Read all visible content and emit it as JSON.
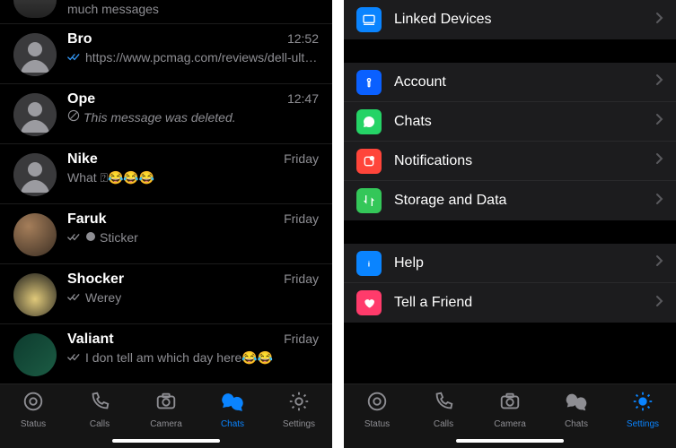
{
  "left": {
    "partial": {
      "msg": "much messages"
    },
    "chats": [
      {
        "name": "Bro",
        "time": "12:52",
        "ticks": "read",
        "msg": "https://www.pcmag.com/reviews/dell-ultrasharp-43-4k-usb-c-monito…",
        "avatar": "default"
      },
      {
        "name": "Ope",
        "time": "12:47",
        "ticks": "none",
        "prefix": "deleted",
        "msg": "This message was deleted.",
        "avatar": "default"
      },
      {
        "name": "Nike",
        "time": "Friday",
        "ticks": "none",
        "msg": "What ⍰😂😂😂",
        "avatar": "default"
      },
      {
        "name": "Faruk",
        "time": "Friday",
        "ticks": "sent",
        "prefix": "sticker",
        "msg": "Sticker",
        "avatar": "photo1"
      },
      {
        "name": "Shocker",
        "time": "Friday",
        "ticks": "sent",
        "msg": "Werey",
        "avatar": "photo2"
      },
      {
        "name": "Valiant",
        "time": "Friday",
        "ticks": "sent",
        "msg": "I don tell am which day here😂😂",
        "avatar": "photo3"
      }
    ]
  },
  "right": {
    "groups": [
      [
        {
          "icon": "linked",
          "label": "Linked Devices"
        }
      ],
      [
        {
          "icon": "account",
          "label": "Account"
        },
        {
          "icon": "chats",
          "label": "Chats"
        },
        {
          "icon": "notif",
          "label": "Notifications"
        },
        {
          "icon": "storage",
          "label": "Storage and Data"
        }
      ],
      [
        {
          "icon": "help",
          "label": "Help"
        },
        {
          "icon": "tell",
          "label": "Tell a Friend"
        }
      ]
    ]
  },
  "tabs": {
    "items": [
      {
        "id": "status",
        "label": "Status"
      },
      {
        "id": "calls",
        "label": "Calls"
      },
      {
        "id": "camera",
        "label": "Camera"
      },
      {
        "id": "chats",
        "label": "Chats"
      },
      {
        "id": "settings",
        "label": "Settings"
      }
    ],
    "active_left": "chats",
    "active_right": "settings"
  }
}
